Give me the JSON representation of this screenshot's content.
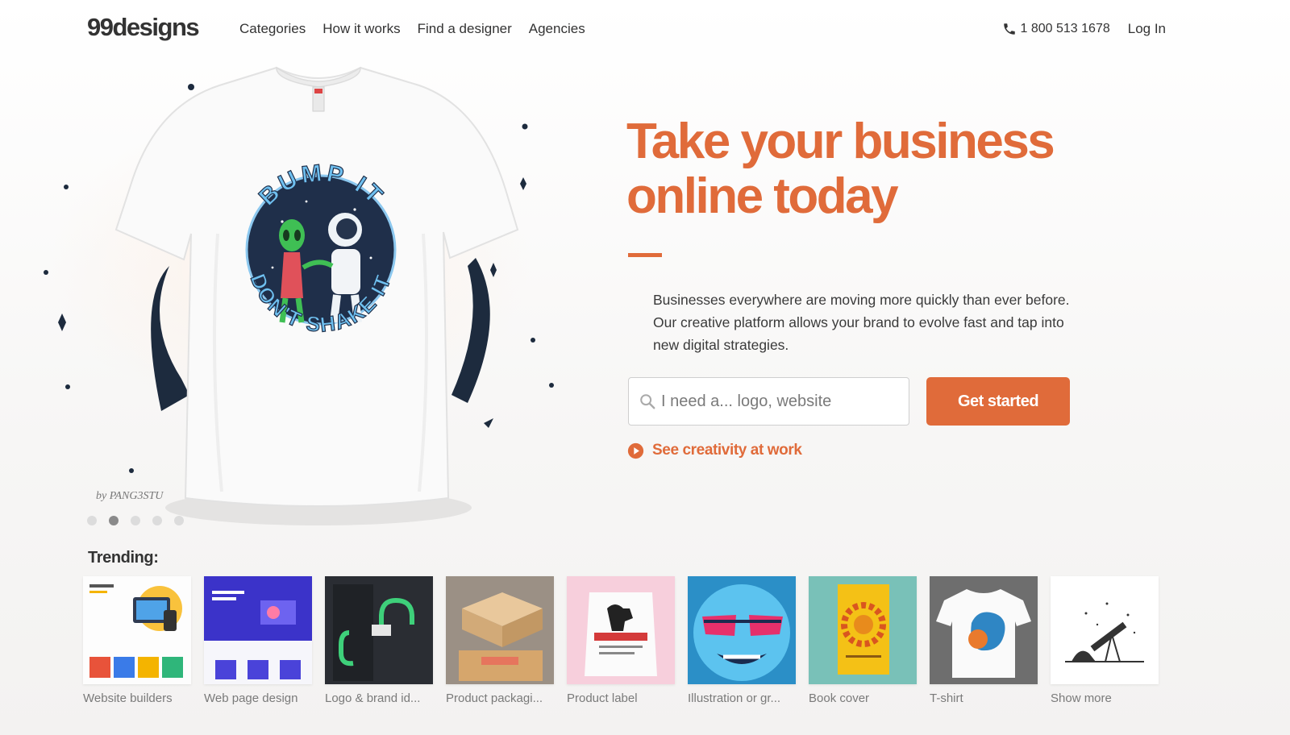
{
  "nav": {
    "logo": "99designs",
    "links": [
      "Categories",
      "How it works",
      "Find a designer",
      "Agencies"
    ],
    "phone": "1 800 513 1678",
    "login": "Log In"
  },
  "hero": {
    "headline": "Take your business online today",
    "description": "Businesses everywhere are moving more quickly than ever before. Our creative platform allows your brand to evolve fast and tap into new digital strategies.",
    "search_placeholder": "I need a... logo, website",
    "cta": "Get started",
    "see_creativity": "See creativity at work",
    "credit": "by PANG3STU",
    "carousel_active_index": 1,
    "carousel_count": 5,
    "shirt_text_top": "BUMP IT",
    "shirt_text_bottom": "DON'T SHAKE IT"
  },
  "trending": {
    "title": "Trending:",
    "items": [
      {
        "label": "Website builders",
        "icon": "website-thumb"
      },
      {
        "label": "Web page design",
        "icon": "webpage-thumb"
      },
      {
        "label": "Logo & brand id...",
        "icon": "brand-thumb"
      },
      {
        "label": "Product packagi...",
        "icon": "packaging-thumb"
      },
      {
        "label": "Product label",
        "icon": "label-thumb"
      },
      {
        "label": "Illustration or gr...",
        "icon": "illustration-thumb"
      },
      {
        "label": "Book cover",
        "icon": "book-thumb"
      },
      {
        "label": "T-shirt",
        "icon": "tshirt-thumb"
      },
      {
        "label": "Show more",
        "icon": "telescope-thumb"
      }
    ]
  },
  "colors": {
    "accent": "#e06b3a",
    "text": "#333333",
    "muted": "#7a7a7a"
  }
}
